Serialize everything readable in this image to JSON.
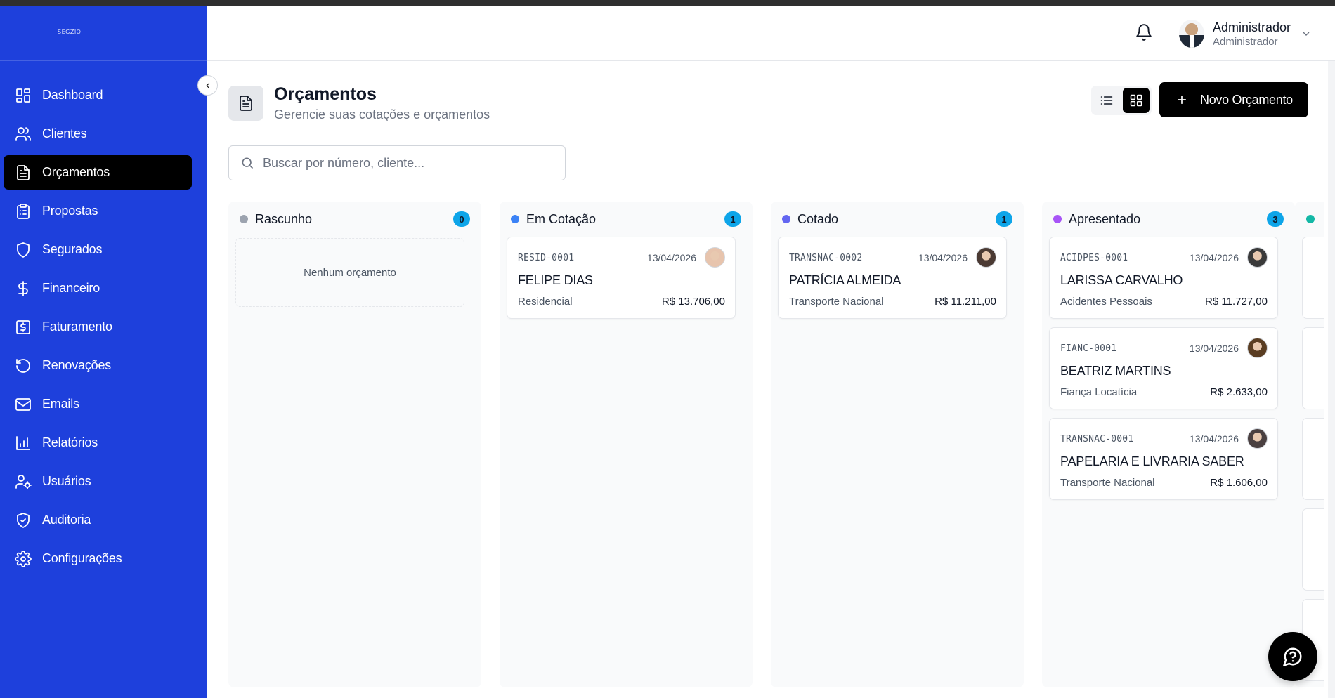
{
  "brand": {
    "logo_text": "SEGZIO"
  },
  "sidebar": {
    "items": [
      {
        "label": "Dashboard",
        "icon": "layout-dashboard-icon",
        "active": false
      },
      {
        "label": "Clientes",
        "icon": "users-icon",
        "active": false
      },
      {
        "label": "Orçamentos",
        "icon": "file-text-icon",
        "active": true
      },
      {
        "label": "Propostas",
        "icon": "clipboard-list-icon",
        "active": false
      },
      {
        "label": "Segurados",
        "icon": "shield-icon",
        "active": false
      },
      {
        "label": "Financeiro",
        "icon": "dollar-sign-icon",
        "active": false
      },
      {
        "label": "Faturamento",
        "icon": "receipt-icon",
        "active": false
      },
      {
        "label": "Renovações",
        "icon": "rotate-ccw-icon",
        "active": false
      },
      {
        "label": "Emails",
        "icon": "mail-icon",
        "active": false
      },
      {
        "label": "Relatórios",
        "icon": "bar-chart-icon",
        "active": false
      },
      {
        "label": "Usuários",
        "icon": "user-cog-icon",
        "active": false
      },
      {
        "label": "Auditoria",
        "icon": "shield-check-icon",
        "active": false
      },
      {
        "label": "Configurações",
        "icon": "settings-icon",
        "active": false
      }
    ]
  },
  "header": {
    "user_name": "Administrador",
    "user_role": "Administrador"
  },
  "page": {
    "title": "Orçamentos",
    "subtitle": "Gerencie suas cotações e orçamentos",
    "new_button": "Novo Orçamento",
    "view_mode": "kanban"
  },
  "search": {
    "placeholder": "Buscar por número, cliente...",
    "value": ""
  },
  "columns": [
    {
      "title": "Rascunho",
      "color": "#9ca3af",
      "count": "0",
      "empty_text": "Nenhum orçamento",
      "cards": []
    },
    {
      "title": "Em Cotação",
      "color": "#3b82f6",
      "count": "1",
      "cards": [
        {
          "code": "RESID-0001",
          "date": "13/04/2026",
          "name": "FELIPE DIAS",
          "type": "Residencial",
          "value": "R$ 13.706,00",
          "avatar": "#e7c4ad"
        }
      ]
    },
    {
      "title": "Cotado",
      "color": "#6366f1",
      "count": "1",
      "cards": [
        {
          "code": "TRANSNAC-0002",
          "date": "13/04/2026",
          "name": "PATRÍCIA ALMEIDA",
          "type": "Transporte Nacional",
          "value": "R$ 11.211,00",
          "avatar": "#4b3a33"
        }
      ]
    },
    {
      "title": "Apresentado",
      "color": "#a855f7",
      "count": "3",
      "cards": [
        {
          "code": "ACIDPES-0001",
          "date": "13/04/2026",
          "name": "LARISSA CARVALHO",
          "type": "Acidentes Pessoais",
          "value": "R$ 11.727,00",
          "avatar": "#3a3a3a"
        },
        {
          "code": "FIANC-0001",
          "date": "13/04/2026",
          "name": "BEATRIZ MARTINS",
          "type": "Fiança Locatícia",
          "value": "R$ 2.633,00",
          "avatar": "#5a3d22"
        },
        {
          "code": "TRANSNAC-0001",
          "date": "13/04/2026",
          "name": "PAPELARIA E LIVRARIA SABER",
          "type": "Transporte Nacional",
          "value": "R$ 1.606,00",
          "avatar": "#4a4040"
        }
      ]
    }
  ],
  "colors": {
    "sidebar_bg": "#1e40dc",
    "badge": "#0ea5e9",
    "primary_button": "#000000"
  }
}
